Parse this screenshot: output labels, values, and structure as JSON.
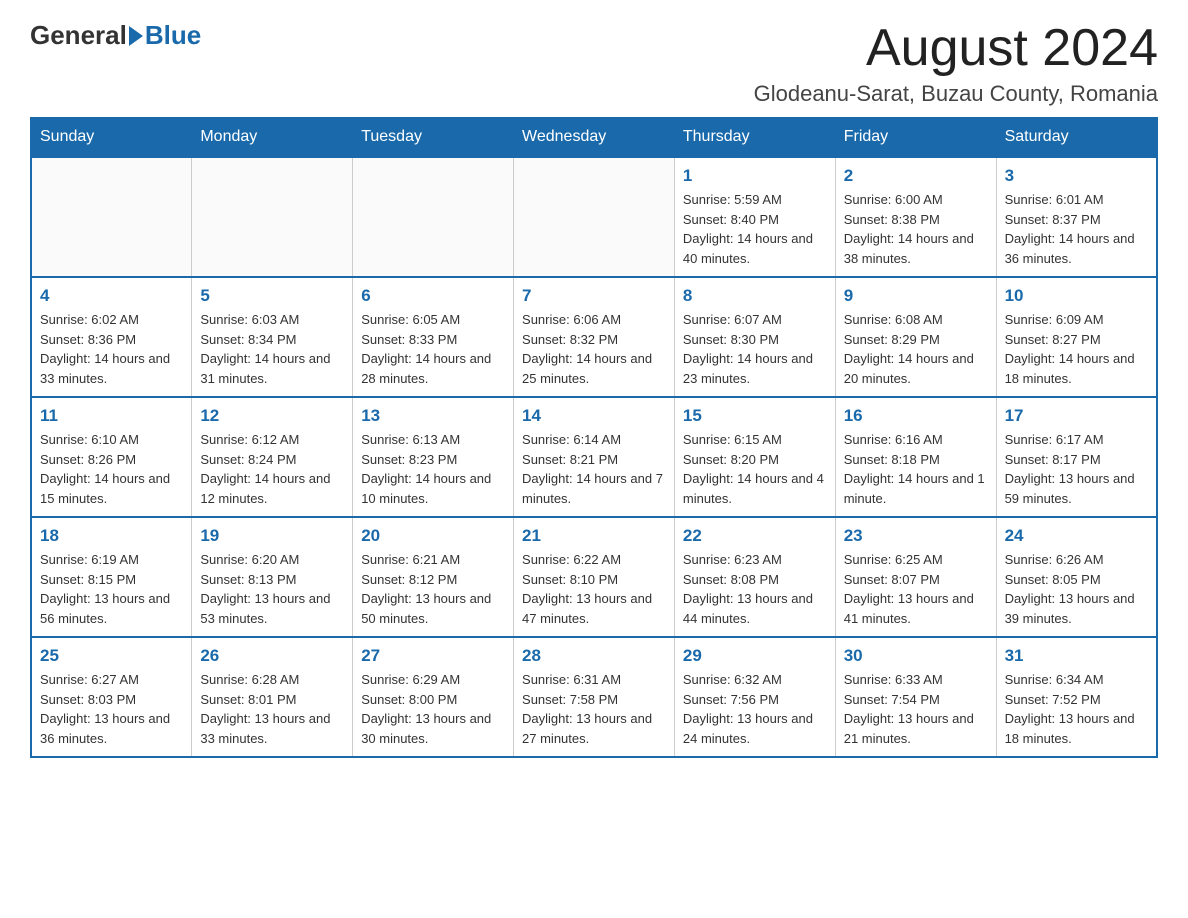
{
  "header": {
    "logo_general": "General",
    "logo_blue": "Blue",
    "main_title": "August 2024",
    "subtitle": "Glodeanu-Sarat, Buzau County, Romania"
  },
  "calendar": {
    "days_of_week": [
      "Sunday",
      "Monday",
      "Tuesday",
      "Wednesday",
      "Thursday",
      "Friday",
      "Saturday"
    ],
    "weeks": [
      [
        {
          "day": "",
          "info": ""
        },
        {
          "day": "",
          "info": ""
        },
        {
          "day": "",
          "info": ""
        },
        {
          "day": "",
          "info": ""
        },
        {
          "day": "1",
          "info": "Sunrise: 5:59 AM\nSunset: 8:40 PM\nDaylight: 14 hours and 40 minutes."
        },
        {
          "day": "2",
          "info": "Sunrise: 6:00 AM\nSunset: 8:38 PM\nDaylight: 14 hours and 38 minutes."
        },
        {
          "day": "3",
          "info": "Sunrise: 6:01 AM\nSunset: 8:37 PM\nDaylight: 14 hours and 36 minutes."
        }
      ],
      [
        {
          "day": "4",
          "info": "Sunrise: 6:02 AM\nSunset: 8:36 PM\nDaylight: 14 hours and 33 minutes."
        },
        {
          "day": "5",
          "info": "Sunrise: 6:03 AM\nSunset: 8:34 PM\nDaylight: 14 hours and 31 minutes."
        },
        {
          "day": "6",
          "info": "Sunrise: 6:05 AM\nSunset: 8:33 PM\nDaylight: 14 hours and 28 minutes."
        },
        {
          "day": "7",
          "info": "Sunrise: 6:06 AM\nSunset: 8:32 PM\nDaylight: 14 hours and 25 minutes."
        },
        {
          "day": "8",
          "info": "Sunrise: 6:07 AM\nSunset: 8:30 PM\nDaylight: 14 hours and 23 minutes."
        },
        {
          "day": "9",
          "info": "Sunrise: 6:08 AM\nSunset: 8:29 PM\nDaylight: 14 hours and 20 minutes."
        },
        {
          "day": "10",
          "info": "Sunrise: 6:09 AM\nSunset: 8:27 PM\nDaylight: 14 hours and 18 minutes."
        }
      ],
      [
        {
          "day": "11",
          "info": "Sunrise: 6:10 AM\nSunset: 8:26 PM\nDaylight: 14 hours and 15 minutes."
        },
        {
          "day": "12",
          "info": "Sunrise: 6:12 AM\nSunset: 8:24 PM\nDaylight: 14 hours and 12 minutes."
        },
        {
          "day": "13",
          "info": "Sunrise: 6:13 AM\nSunset: 8:23 PM\nDaylight: 14 hours and 10 minutes."
        },
        {
          "day": "14",
          "info": "Sunrise: 6:14 AM\nSunset: 8:21 PM\nDaylight: 14 hours and 7 minutes."
        },
        {
          "day": "15",
          "info": "Sunrise: 6:15 AM\nSunset: 8:20 PM\nDaylight: 14 hours and 4 minutes."
        },
        {
          "day": "16",
          "info": "Sunrise: 6:16 AM\nSunset: 8:18 PM\nDaylight: 14 hours and 1 minute."
        },
        {
          "day": "17",
          "info": "Sunrise: 6:17 AM\nSunset: 8:17 PM\nDaylight: 13 hours and 59 minutes."
        }
      ],
      [
        {
          "day": "18",
          "info": "Sunrise: 6:19 AM\nSunset: 8:15 PM\nDaylight: 13 hours and 56 minutes."
        },
        {
          "day": "19",
          "info": "Sunrise: 6:20 AM\nSunset: 8:13 PM\nDaylight: 13 hours and 53 minutes."
        },
        {
          "day": "20",
          "info": "Sunrise: 6:21 AM\nSunset: 8:12 PM\nDaylight: 13 hours and 50 minutes."
        },
        {
          "day": "21",
          "info": "Sunrise: 6:22 AM\nSunset: 8:10 PM\nDaylight: 13 hours and 47 minutes."
        },
        {
          "day": "22",
          "info": "Sunrise: 6:23 AM\nSunset: 8:08 PM\nDaylight: 13 hours and 44 minutes."
        },
        {
          "day": "23",
          "info": "Sunrise: 6:25 AM\nSunset: 8:07 PM\nDaylight: 13 hours and 41 minutes."
        },
        {
          "day": "24",
          "info": "Sunrise: 6:26 AM\nSunset: 8:05 PM\nDaylight: 13 hours and 39 minutes."
        }
      ],
      [
        {
          "day": "25",
          "info": "Sunrise: 6:27 AM\nSunset: 8:03 PM\nDaylight: 13 hours and 36 minutes."
        },
        {
          "day": "26",
          "info": "Sunrise: 6:28 AM\nSunset: 8:01 PM\nDaylight: 13 hours and 33 minutes."
        },
        {
          "day": "27",
          "info": "Sunrise: 6:29 AM\nSunset: 8:00 PM\nDaylight: 13 hours and 30 minutes."
        },
        {
          "day": "28",
          "info": "Sunrise: 6:31 AM\nSunset: 7:58 PM\nDaylight: 13 hours and 27 minutes."
        },
        {
          "day": "29",
          "info": "Sunrise: 6:32 AM\nSunset: 7:56 PM\nDaylight: 13 hours and 24 minutes."
        },
        {
          "day": "30",
          "info": "Sunrise: 6:33 AM\nSunset: 7:54 PM\nDaylight: 13 hours and 21 minutes."
        },
        {
          "day": "31",
          "info": "Sunrise: 6:34 AM\nSunset: 7:52 PM\nDaylight: 13 hours and 18 minutes."
        }
      ]
    ]
  }
}
